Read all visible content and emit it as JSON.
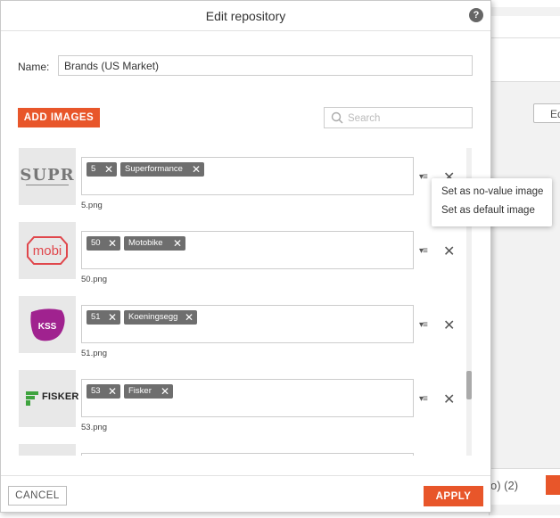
{
  "dialog": {
    "title": "Edit repository",
    "help_label": "?"
  },
  "form": {
    "name_label": "Name:",
    "name_value": "Brands (US Market)"
  },
  "toolbar": {
    "add_images_label": "ADD IMAGES",
    "search_placeholder": "Search"
  },
  "items": [
    {
      "logo": "SUPR",
      "filename": "5.png",
      "tags": [
        "5",
        "Superformance"
      ]
    },
    {
      "logo": "mobi",
      "filename": "50.png",
      "tags": [
        "50",
        "Motobike"
      ]
    },
    {
      "logo": "KSS",
      "filename": "51.png",
      "tags": [
        "51",
        "Koeningsegg"
      ]
    },
    {
      "logo": "FISKER",
      "filename": "53.png",
      "tags": [
        "53",
        "Fisker"
      ]
    }
  ],
  "context_menu": {
    "items": [
      "Set as no-value image",
      "Set as default image"
    ]
  },
  "footer": {
    "cancel_label": "CANCEL",
    "apply_label": "APPLY"
  },
  "background": {
    "button_fragment": "Ed",
    "status_fragment": "o) (2)"
  },
  "icons": {
    "tag_remove": "✕",
    "row_remove": "✕",
    "row_menu": "▾≡"
  },
  "colors": {
    "accent": "#e8562a",
    "tag_bg": "#6e6e6e",
    "mobi_red": "#e0474c",
    "kss_purple": "#a0228f",
    "fisker_green": "#3ea33e"
  }
}
